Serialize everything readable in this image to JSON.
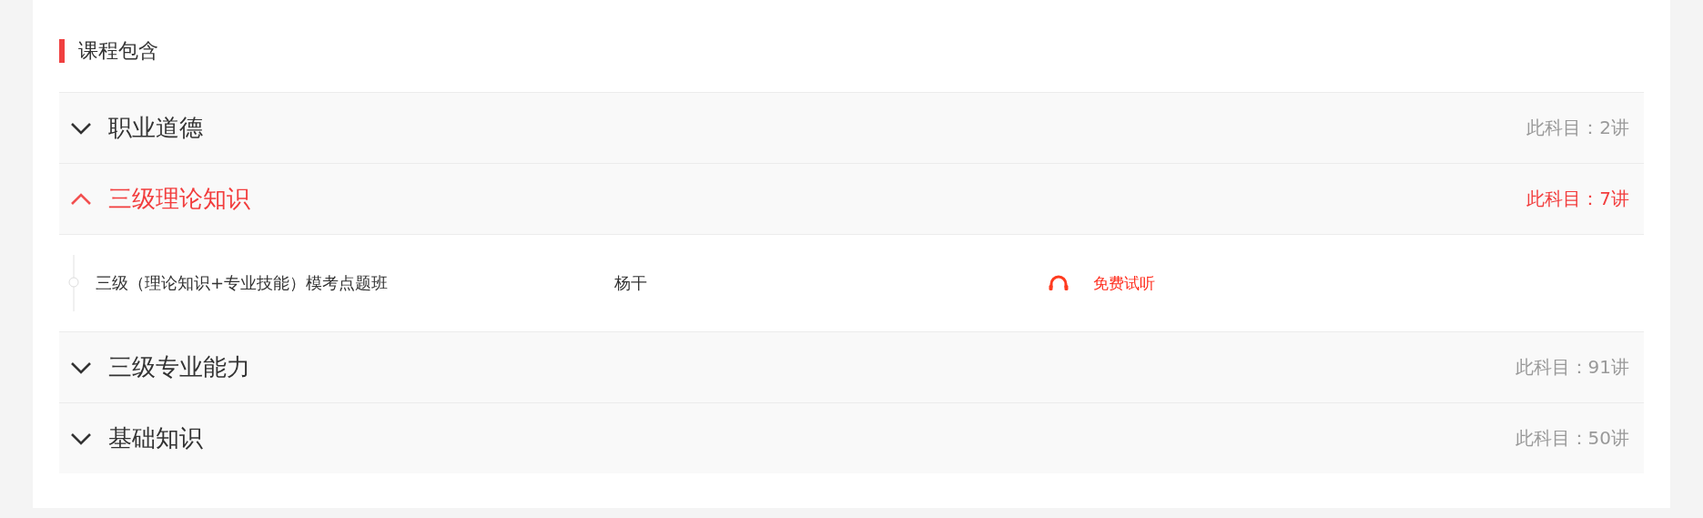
{
  "heading": "课程包含",
  "subjects": [
    {
      "title": "职业道德",
      "count": "此科目：2讲",
      "expanded": false
    },
    {
      "title": "三级理论知识",
      "count": "此科目：7讲",
      "expanded": true,
      "lessons": [
        {
          "title": "三级（理论知识+专业技能）模考点题班",
          "teacher": "杨干",
          "action": "免费试听"
        }
      ]
    },
    {
      "title": "三级专业能力",
      "count": "此科目：91讲",
      "expanded": false
    },
    {
      "title": "基础知识",
      "count": "此科目：50讲",
      "expanded": false
    }
  ]
}
